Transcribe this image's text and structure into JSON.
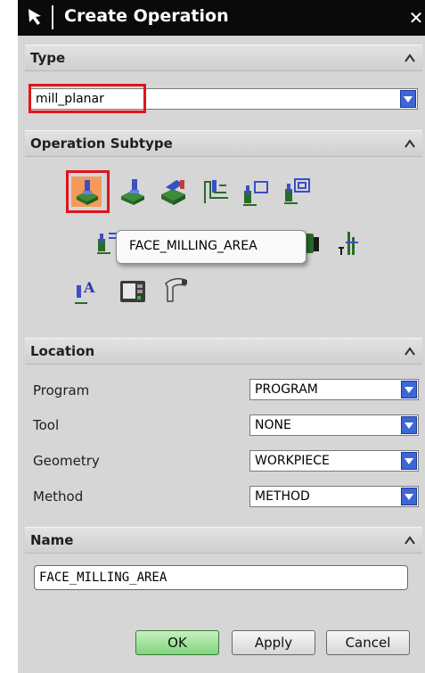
{
  "window": {
    "title": "Create Operation"
  },
  "type_section": {
    "header": "Type",
    "selected": "mill_planar"
  },
  "subtype_section": {
    "header": "Operation Subtype",
    "tooltip": "FACE_MILLING_AREA",
    "icons": [
      "face-milling-area-icon",
      "face-milling-icon",
      "face-milling-manual-icon",
      "planar-mill-icon",
      "planar-profile-icon",
      "cleanup-corners-icon",
      "finish-walls-icon",
      "finish-floor-icon",
      "thread-milling-icon",
      "planar-text-icon",
      "mill-control-icon",
      "mill-user-icon"
    ]
  },
  "location_section": {
    "header": "Location",
    "program_label": "Program",
    "program_value": "PROGRAM",
    "tool_label": "Tool",
    "tool_value": "NONE",
    "geometry_label": "Geometry",
    "geometry_value": "WORKPIECE",
    "method_label": "Method",
    "method_value": "METHOD"
  },
  "name_section": {
    "header": "Name",
    "value": "FACE_MILLING_AREA"
  },
  "buttons": {
    "ok": "OK",
    "apply": "Apply",
    "cancel": "Cancel"
  },
  "colors": {
    "accent": "#3d66d6",
    "highlight": "#e0141b",
    "ok_button": "#7fd47a",
    "titlebar": "#0a0a0a"
  }
}
